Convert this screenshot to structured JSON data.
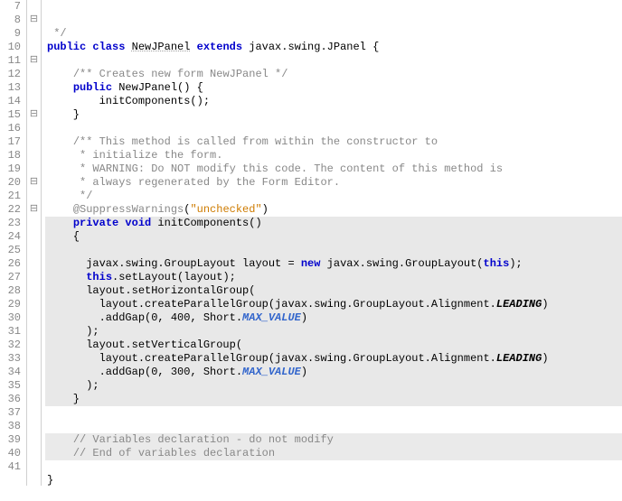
{
  "lines": [
    {
      "n": "7",
      "fold": "",
      "bg": "",
      "frag": [
        [
          "comment",
          " */"
        ]
      ]
    },
    {
      "n": "8",
      "fold": "−",
      "bg": "",
      "frag": [
        [
          "kw",
          "public class "
        ],
        [
          "cls-name",
          "NewJPanel"
        ],
        [
          "kw",
          " extends "
        ],
        [
          "type",
          "javax.swing.JPanel"
        ],
        [
          "",
          " {"
        ]
      ]
    },
    {
      "n": "9",
      "fold": "",
      "bg": "",
      "frag": [
        [
          "",
          ""
        ]
      ]
    },
    {
      "n": "10",
      "fold": "",
      "bg": "",
      "frag": [
        [
          "",
          "    "
        ],
        [
          "comment",
          "/** Creates new form NewJPanel */"
        ]
      ]
    },
    {
      "n": "11",
      "fold": "−",
      "bg": "",
      "frag": [
        [
          "",
          "    "
        ],
        [
          "kw",
          "public"
        ],
        [
          "",
          " NewJPanel() {"
        ]
      ]
    },
    {
      "n": "12",
      "fold": "",
      "bg": "",
      "frag": [
        [
          "",
          "        initComponents();"
        ]
      ]
    },
    {
      "n": "13",
      "fold": "",
      "bg": "",
      "frag": [
        [
          "",
          "    }"
        ]
      ]
    },
    {
      "n": "14",
      "fold": "",
      "bg": "",
      "frag": [
        [
          "",
          ""
        ]
      ]
    },
    {
      "n": "15",
      "fold": "−",
      "bg": "",
      "frag": [
        [
          "",
          "    "
        ],
        [
          "comment",
          "/** This method is called from within the constructor to"
        ]
      ]
    },
    {
      "n": "16",
      "fold": "",
      "bg": "",
      "frag": [
        [
          "",
          "    "
        ],
        [
          "comment",
          " * initialize the form."
        ]
      ]
    },
    {
      "n": "17",
      "fold": "",
      "bg": "",
      "frag": [
        [
          "",
          "    "
        ],
        [
          "comment",
          " * WARNING: Do NOT modify this code. The content of this method is"
        ]
      ]
    },
    {
      "n": "18",
      "fold": "",
      "bg": "",
      "frag": [
        [
          "",
          "    "
        ],
        [
          "comment",
          " * always regenerated by the Form Editor."
        ]
      ]
    },
    {
      "n": "19",
      "fold": "",
      "bg": "",
      "frag": [
        [
          "",
          "    "
        ],
        [
          "comment",
          " */"
        ]
      ]
    },
    {
      "n": "20",
      "fold": "−",
      "bg": "",
      "frag": [
        [
          "",
          "    "
        ],
        [
          "ann",
          "@SuppressWarnings"
        ],
        [
          "",
          "("
        ],
        [
          "string",
          "\"unchecked\""
        ],
        [
          "",
          ")"
        ]
      ]
    },
    {
      "n": "21",
      "fold": "",
      "bg": "hl",
      "frag": [
        [
          "",
          "    "
        ],
        [
          "kw",
          "private void"
        ],
        [
          "",
          " initComponents()"
        ]
      ]
    },
    {
      "n": "22",
      "fold": "−",
      "bg": "hl",
      "frag": [
        [
          "",
          "    {"
        ]
      ]
    },
    {
      "n": "23",
      "fold": "",
      "bg": "hl",
      "frag": [
        [
          "",
          ""
        ]
      ]
    },
    {
      "n": "24",
      "fold": "",
      "bg": "hl",
      "frag": [
        [
          "",
          "      javax.swing.GroupLayout layout = "
        ],
        [
          "kw",
          "new"
        ],
        [
          "",
          " javax.swing.GroupLayout("
        ],
        [
          "this",
          "this"
        ],
        [
          "",
          ");"
        ]
      ]
    },
    {
      "n": "25",
      "fold": "",
      "bg": "hl",
      "frag": [
        [
          "",
          "      "
        ],
        [
          "this",
          "this"
        ],
        [
          "",
          ".setLayout(layout);"
        ]
      ]
    },
    {
      "n": "26",
      "fold": "",
      "bg": "hl",
      "frag": [
        [
          "",
          "      layout.setHorizontalGroup("
        ]
      ]
    },
    {
      "n": "27",
      "fold": "",
      "bg": "hl",
      "frag": [
        [
          "",
          "        layout.createParallelGroup(javax.swing.GroupLayout.Alignment."
        ],
        [
          "enum",
          "LEADING"
        ],
        [
          "",
          ")"
        ]
      ]
    },
    {
      "n": "28",
      "fold": "",
      "bg": "hl",
      "frag": [
        [
          "",
          "        .addGap("
        ],
        [
          "num",
          "0"
        ],
        [
          "",
          ", "
        ],
        [
          "num",
          "400"
        ],
        [
          "",
          ", Short."
        ],
        [
          "const",
          "MAX_VALUE"
        ],
        [
          "",
          ")"
        ]
      ]
    },
    {
      "n": "29",
      "fold": "",
      "bg": "hl",
      "frag": [
        [
          "",
          "      );"
        ]
      ]
    },
    {
      "n": "30",
      "fold": "",
      "bg": "hl",
      "frag": [
        [
          "",
          "      layout.setVerticalGroup("
        ]
      ]
    },
    {
      "n": "31",
      "fold": "",
      "bg": "hl",
      "frag": [
        [
          "",
          "        layout.createParallelGroup(javax.swing.GroupLayout.Alignment."
        ],
        [
          "enum",
          "LEADING"
        ],
        [
          "",
          ")"
        ]
      ]
    },
    {
      "n": "32",
      "fold": "",
      "bg": "hl",
      "frag": [
        [
          "",
          "        .addGap("
        ],
        [
          "num",
          "0"
        ],
        [
          "",
          ", "
        ],
        [
          "num",
          "300"
        ],
        [
          "",
          ", Short."
        ],
        [
          "const",
          "MAX_VALUE"
        ],
        [
          "",
          ")"
        ]
      ]
    },
    {
      "n": "33",
      "fold": "",
      "bg": "hl",
      "frag": [
        [
          "",
          "      );"
        ]
      ]
    },
    {
      "n": "34",
      "fold": "",
      "bg": "hl",
      "frag": [
        [
          "",
          "    }"
        ]
      ]
    },
    {
      "n": "35",
      "fold": "",
      "bg": "",
      "frag": [
        [
          "",
          ""
        ]
      ]
    },
    {
      "n": "36",
      "fold": "",
      "bg": "",
      "frag": [
        [
          "",
          ""
        ]
      ]
    },
    {
      "n": "37",
      "fold": "",
      "bg": "hl2",
      "frag": [
        [
          "",
          "    "
        ],
        [
          "comment",
          "// Variables declaration - do not modify"
        ]
      ]
    },
    {
      "n": "38",
      "fold": "",
      "bg": "hl2",
      "frag": [
        [
          "",
          "    "
        ],
        [
          "comment",
          "// End of variables declaration"
        ]
      ]
    },
    {
      "n": "39",
      "fold": "",
      "bg": "",
      "frag": [
        [
          "",
          ""
        ]
      ]
    },
    {
      "n": "40",
      "fold": "",
      "bg": "",
      "frag": [
        [
          "",
          "}"
        ]
      ]
    },
    {
      "n": "41",
      "fold": "",
      "bg": "",
      "frag": [
        [
          "",
          ""
        ]
      ]
    }
  ]
}
